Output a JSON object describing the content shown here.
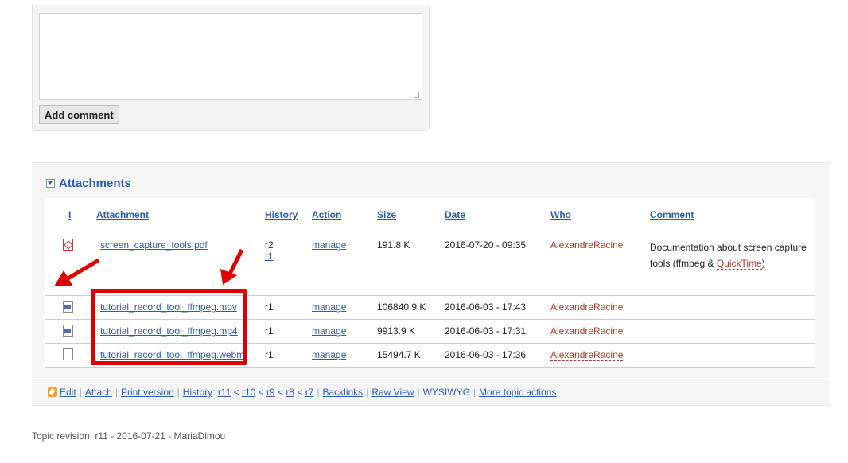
{
  "comment": {
    "button_label": "Add comment"
  },
  "attachments": {
    "heading": "Attachments",
    "columns": {
      "icon": "I",
      "attachment": "Attachment",
      "history": "History",
      "action": "Action",
      "size": "Size",
      "date": "Date",
      "who": "Who",
      "comment": "Comment"
    },
    "rows": [
      {
        "icon": "pdf-icon",
        "name": "screen_capture_tools.pdf",
        "history": "r2",
        "history_link": "r1",
        "action": "manage",
        "size": "191.8 K",
        "date": "2016-07-20 - 09:35",
        "who": "AlexandreRacine",
        "comment_pre": "Documentation about screen capture tools (ffmpeg &",
        "comment_link": "QuickTime",
        "comment_post": ")"
      },
      {
        "icon": "video-file-icon",
        "name": "tutorial_record_tool_ffmpeg.mov",
        "history": "r1",
        "action": "manage",
        "size": "106840.9 K",
        "date": "2016-06-03 - 17:43",
        "who": "AlexandreRacine"
      },
      {
        "icon": "video-file-icon",
        "name": "tutorial_record_tool_ffmpeg.mp4",
        "history": "r1",
        "action": "manage",
        "size": "9913.9 K",
        "date": "2016-06-03 - 17:31",
        "who": "AlexandreRacine"
      },
      {
        "icon": "file-icon",
        "name": "tutorial_record_tool_ffmpeg.webm",
        "history": "r1",
        "action": "manage",
        "size": "15494.7 K",
        "date": "2016-06-03 - 17:36",
        "who": "AlexandreRacine"
      }
    ]
  },
  "actions": {
    "edit": "Edit",
    "attach": "Attach",
    "print": "Print version",
    "history_label": "History",
    "history_links": [
      "r11",
      "r10",
      "r9",
      "r8",
      "r7"
    ],
    "backlinks": "Backlinks",
    "raw_view": "Raw View",
    "wysiwyg": "WYSIWYG",
    "more": "More topic actions"
  },
  "revision": {
    "prefix": "Topic revision: r11 - 2016-07-21 -",
    "author": "MariaDimou"
  },
  "colors": {
    "link": "#2a5db0",
    "user": "#b03a2e",
    "annotation": "#e00000"
  }
}
